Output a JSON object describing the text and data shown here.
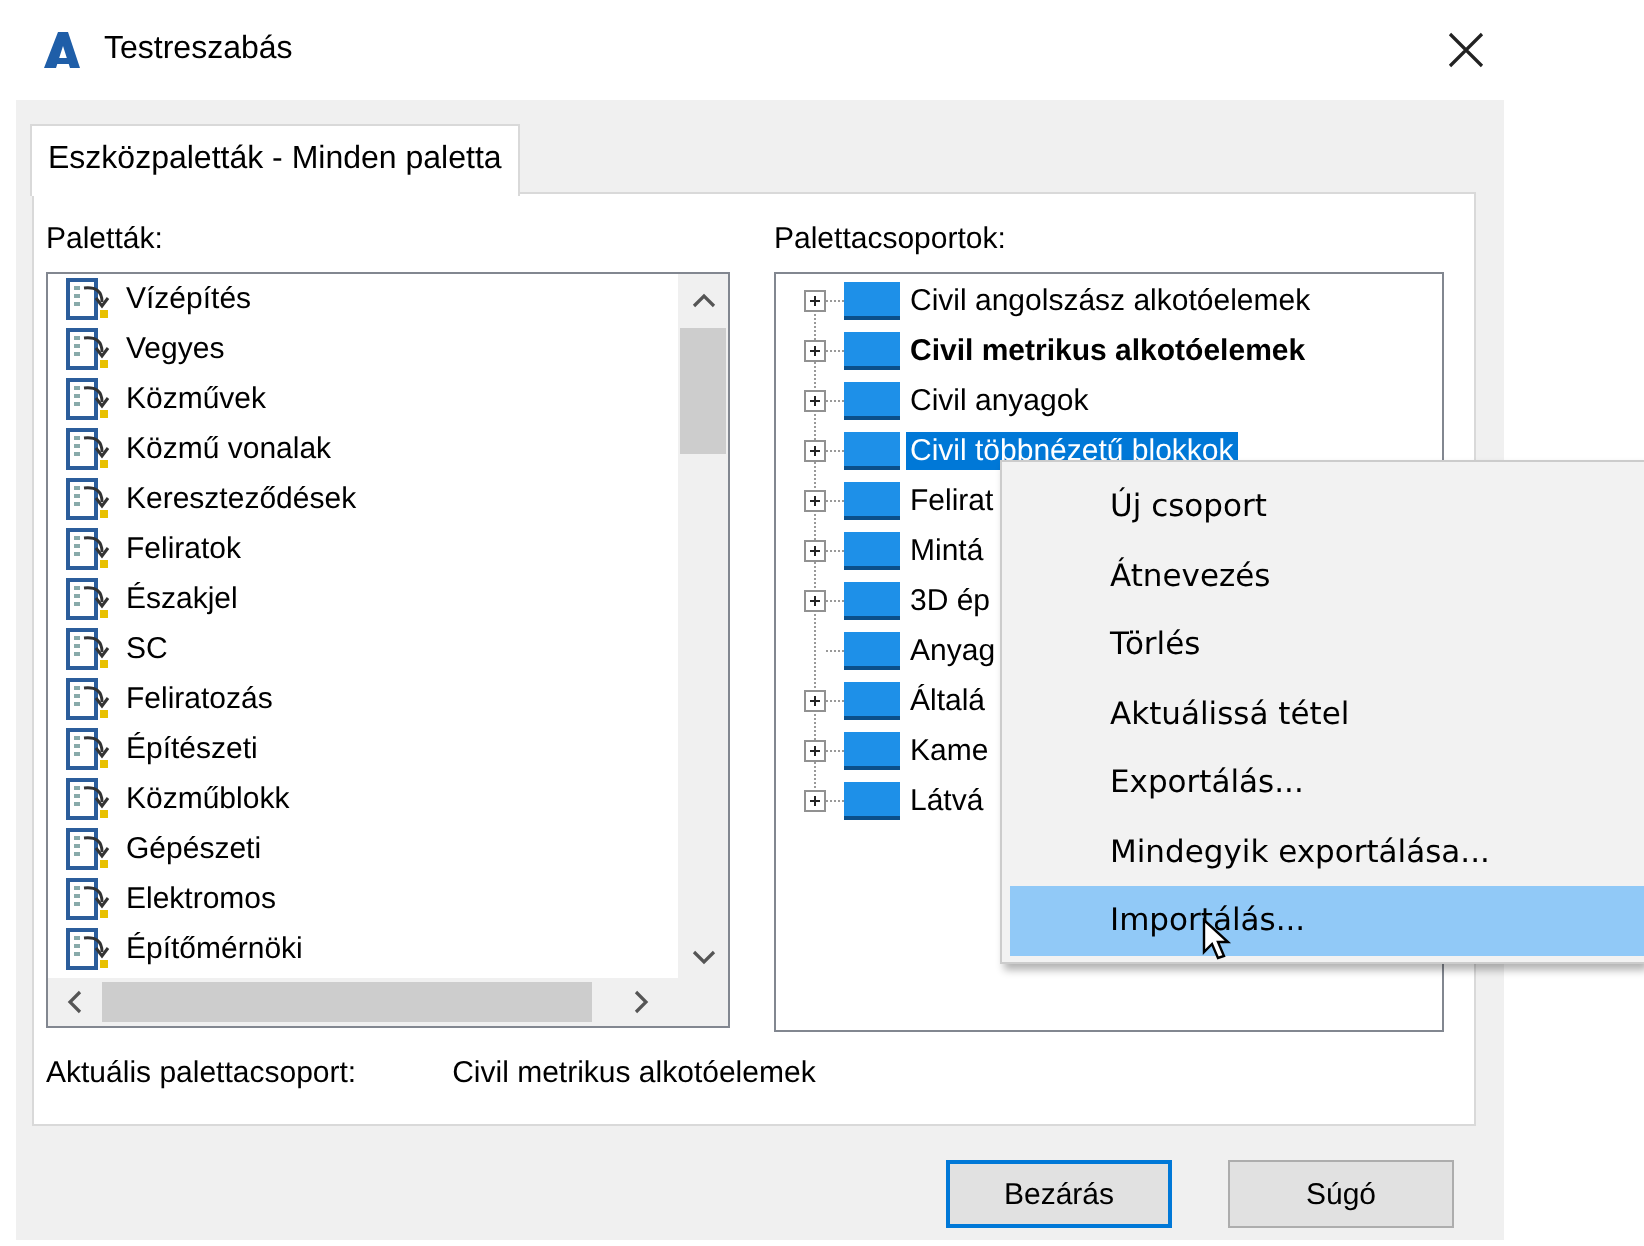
{
  "window": {
    "title": "Testreszabás"
  },
  "tabs": [
    {
      "label": "Eszközpaletták - Minden paletta",
      "selected": true
    }
  ],
  "palettes": {
    "label": "Paletták:",
    "items": [
      "Vízépítés",
      "Vegyes",
      "Közművek",
      "Közmű vonalak",
      "Kereszteződések",
      "Feliratok",
      "Északjel",
      "SC",
      "Feliratozás",
      "Építészeti",
      "Közműblokk",
      "Gépészeti",
      "Elektromos",
      "Építőmérnöki"
    ]
  },
  "groups": {
    "label": "Palettacsoportok:",
    "items": [
      {
        "label": "Civil angolszász alkotóelemek",
        "expandable": true,
        "bold": false,
        "selected": false
      },
      {
        "label": "Civil metrikus alkotóelemek",
        "expandable": true,
        "bold": true,
        "selected": false
      },
      {
        "label": "Civil anyagok",
        "expandable": true,
        "bold": false,
        "selected": false
      },
      {
        "label": "Civil többnézetű blokkok",
        "expandable": true,
        "bold": false,
        "selected": true
      },
      {
        "label": "Felirat",
        "expandable": true,
        "bold": false,
        "selected": false
      },
      {
        "label": "Mintá",
        "expandable": true,
        "bold": false,
        "selected": false
      },
      {
        "label": "3D ép",
        "expandable": true,
        "bold": false,
        "selected": false
      },
      {
        "label": "Anyag",
        "expandable": false,
        "bold": false,
        "selected": false
      },
      {
        "label": "Általá",
        "expandable": true,
        "bold": false,
        "selected": false
      },
      {
        "label": "Kame",
        "expandable": true,
        "bold": false,
        "selected": false
      },
      {
        "label": "Látvá",
        "expandable": true,
        "bold": false,
        "selected": false
      }
    ]
  },
  "current": {
    "label": "Aktuális palettacsoport:",
    "value": "Civil metrikus alkotóelemek"
  },
  "context_menu": [
    {
      "label": "Új csoport",
      "selected": false
    },
    {
      "label": "Átnevezés",
      "selected": false
    },
    {
      "label": "Törlés",
      "selected": false
    },
    {
      "label": "Aktuálissá tétel",
      "selected": false
    },
    {
      "label": "Exportálás...",
      "selected": false
    },
    {
      "label": "Mindegyik exportálása...",
      "selected": false
    },
    {
      "label": "Importálás...",
      "selected": true
    }
  ],
  "buttons": [
    {
      "label": "Bezárás",
      "default": true
    },
    {
      "label": "Súgó",
      "default": false
    }
  ]
}
